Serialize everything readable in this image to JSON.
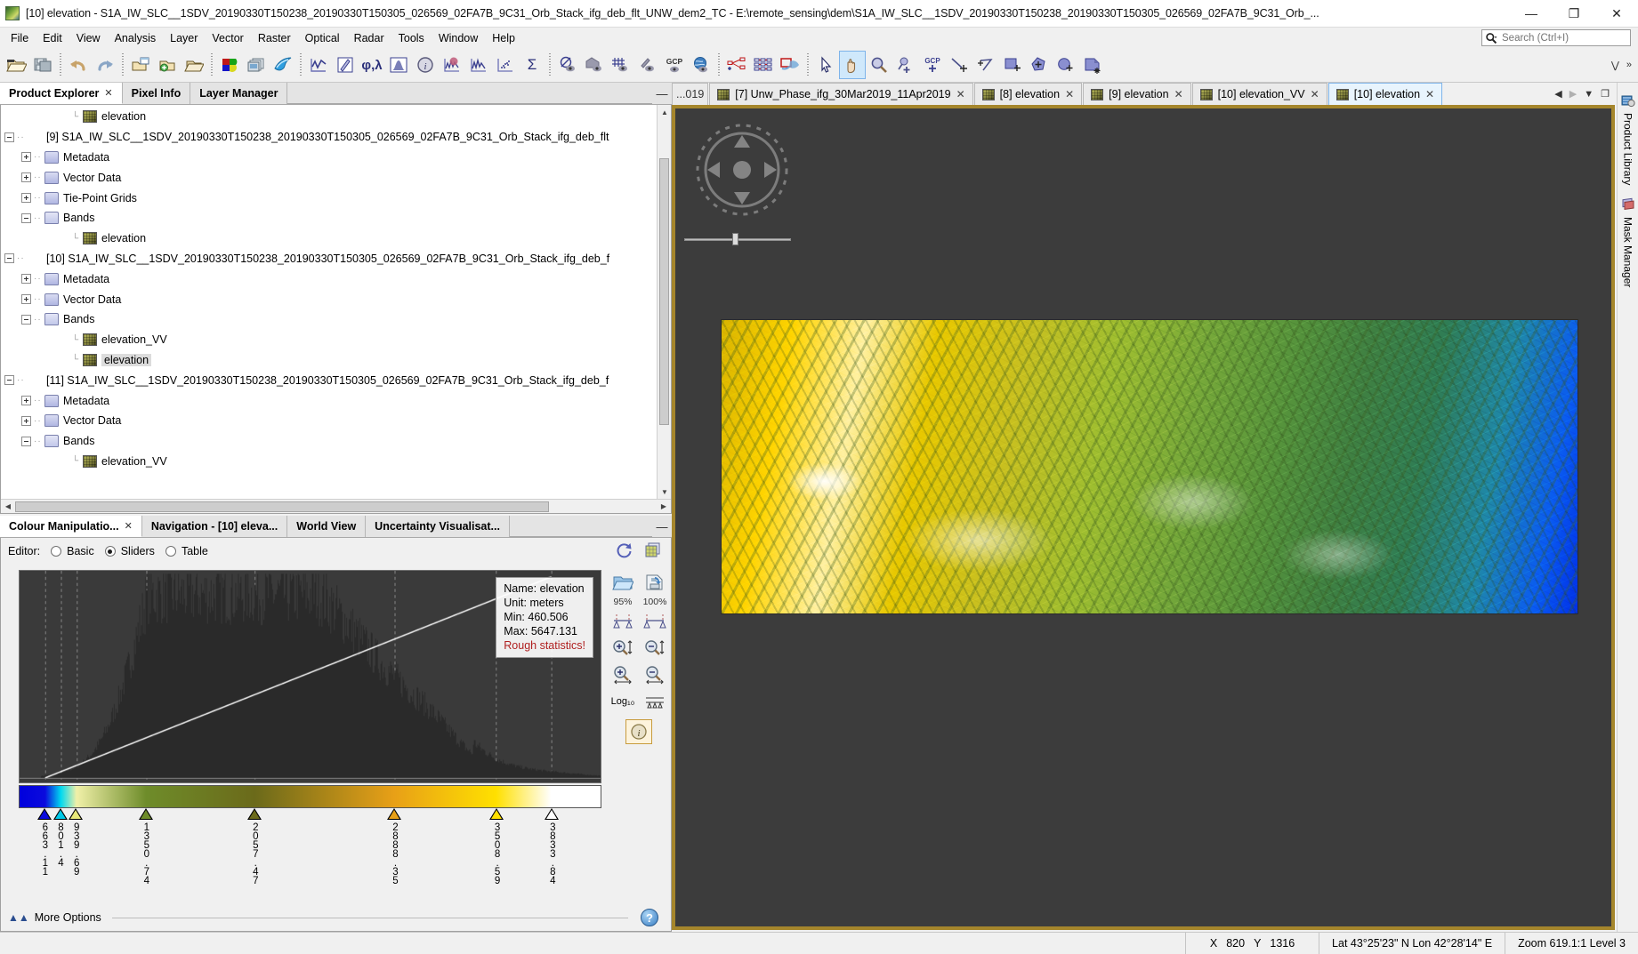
{
  "window": {
    "title": "[10] elevation - S1A_IW_SLC__1SDV_20190330T150238_20190330T150305_026569_02FA7B_9C31_Orb_Stack_ifg_deb_flt_UNW_dem2_TC - E:\\remote_sensing\\dem\\S1A_IW_SLC__1SDV_20190330T150238_20190330T150305_026569_02FA7B_9C31_Orb_...",
    "minimize": "—",
    "maximize": "❐",
    "close": "✕"
  },
  "menu": {
    "items": [
      "File",
      "Edit",
      "View",
      "Analysis",
      "Layer",
      "Vector",
      "Raster",
      "Optical",
      "Radar",
      "Tools",
      "Window",
      "Help"
    ]
  },
  "search": {
    "placeholder": "Search (Ctrl+I)",
    "value": "",
    "icon": "search-icon"
  },
  "toolbar": {
    "groups": [
      [
        {
          "name": "open-product-icon",
          "title": "Open Product"
        },
        {
          "name": "save-product-icon",
          "title": "Save Product"
        }
      ],
      [
        {
          "name": "undo-icon",
          "title": "Undo"
        },
        {
          "name": "redo-icon",
          "title": "Redo"
        }
      ],
      [
        {
          "name": "open-rgb-image-window-icon",
          "title": "Open RGB Image Window"
        },
        {
          "name": "open-image-view-icon",
          "title": "Open Image View"
        },
        {
          "name": "close-image-view-icon",
          "title": "Close Image View"
        }
      ],
      [
        {
          "name": "colour-manipulation-icon",
          "title": "Colour Manipulation"
        },
        {
          "name": "tile-windows-icon",
          "title": "Tile Windows"
        },
        {
          "name": "wave-icon",
          "title": "SAR Wave"
        }
      ],
      [
        {
          "name": "profile-plot-icon",
          "title": "Profile Plot"
        },
        {
          "name": "pin-manager-icon",
          "title": "Pin Manager"
        },
        {
          "name": "geo-coding-icon",
          "title": "Geo-Coding"
        },
        {
          "name": "histogram-icon",
          "title": "Histogram"
        },
        {
          "name": "information-icon",
          "title": "Information"
        },
        {
          "name": "colour-histogram-icon",
          "title": "Colour Histogram"
        },
        {
          "name": "density-plot-icon",
          "title": "Density Plot"
        },
        {
          "name": "scatter-plot-icon",
          "title": "Scatter Plot"
        },
        {
          "name": "statistics-icon",
          "title": "Statistics"
        }
      ],
      [
        {
          "name": "no-data-overlay-icon",
          "title": "No-Data Overlay"
        },
        {
          "name": "geometry-overlay-icon",
          "title": "Geometry Overlay"
        },
        {
          "name": "graticule-overlay-icon",
          "title": "Graticule Overlay"
        },
        {
          "name": "pin-overlay-icon",
          "title": "Pin Overlay"
        },
        {
          "name": "gcp-overlay-icon",
          "title": "GCP Overlay"
        },
        {
          "name": "world-map-overlay-icon",
          "title": "World Map Overlay"
        }
      ],
      [
        {
          "name": "graph-builder-icon",
          "title": "Graph Builder"
        },
        {
          "name": "batch-processing-icon",
          "title": "Batch Processing"
        },
        {
          "name": "subset-icon",
          "title": "Subset"
        }
      ],
      [
        {
          "name": "selection-tool-icon",
          "title": "Selection"
        },
        {
          "name": "pan-tool-icon",
          "title": "Panning",
          "active": true
        },
        {
          "name": "zoom-tool-icon",
          "title": "Zooming"
        },
        {
          "name": "pin-placing-tool-icon",
          "title": "Pin placing tool"
        },
        {
          "name": "gcp-placing-tool-icon",
          "title": "GCP placing tool"
        },
        {
          "name": "line-drawing-tool-icon",
          "title": "Line drawing tool"
        },
        {
          "name": "polyline-drawing-tool-icon",
          "title": "Polyline drawing tool"
        },
        {
          "name": "rectangle-drawing-tool-icon",
          "title": "Rectangle drawing tool"
        },
        {
          "name": "polygon-drawing-tool-icon",
          "title": "Polygon drawing tool"
        },
        {
          "name": "ellipse-drawing-tool-icon",
          "title": "Ellipse drawing tool"
        },
        {
          "name": "magic-wand-tool-icon",
          "title": "Magic wand tool"
        }
      ]
    ],
    "overflow_down": "⋁",
    "overflow_right": "»"
  },
  "left_panel": {
    "tabs": [
      {
        "label": "Product Explorer",
        "selected": true,
        "closable": true
      },
      {
        "label": "Pixel Info",
        "selected": false,
        "closable": false
      },
      {
        "label": "Layer Manager",
        "selected": false,
        "closable": false
      }
    ],
    "minimize": "—"
  },
  "tree": {
    "rows": [
      {
        "indent": 4,
        "toggle": "none",
        "icon": "band",
        "label": "elevation",
        "selected": false
      },
      {
        "indent": 0,
        "toggle": "minus",
        "icon": "product",
        "label": "[9] S1A_IW_SLC__1SDV_20190330T150238_20190330T150305_026569_02FA7B_9C31_Orb_Stack_ifg_deb_flt",
        "selected": false
      },
      {
        "indent": 1,
        "toggle": "plus",
        "icon": "folder",
        "label": "Metadata",
        "selected": false
      },
      {
        "indent": 1,
        "toggle": "plus",
        "icon": "folder",
        "label": "Vector Data",
        "selected": false
      },
      {
        "indent": 1,
        "toggle": "plus",
        "icon": "folder",
        "label": "Tie-Point Grids",
        "selected": false
      },
      {
        "indent": 1,
        "toggle": "minus",
        "icon": "folder-open",
        "label": "Bands",
        "selected": false
      },
      {
        "indent": 4,
        "toggle": "none",
        "icon": "band",
        "label": "elevation",
        "selected": false
      },
      {
        "indent": 0,
        "toggle": "minus",
        "icon": "product",
        "label": "[10] S1A_IW_SLC__1SDV_20190330T150238_20190330T150305_026569_02FA7B_9C31_Orb_Stack_ifg_deb_f",
        "selected": false
      },
      {
        "indent": 1,
        "toggle": "plus",
        "icon": "folder",
        "label": "Metadata",
        "selected": false
      },
      {
        "indent": 1,
        "toggle": "plus",
        "icon": "folder",
        "label": "Vector Data",
        "selected": false
      },
      {
        "indent": 1,
        "toggle": "minus",
        "icon": "folder-open",
        "label": "Bands",
        "selected": false
      },
      {
        "indent": 4,
        "toggle": "none",
        "icon": "band",
        "label": "elevation_VV",
        "selected": false
      },
      {
        "indent": 4,
        "toggle": "none",
        "icon": "band",
        "label": "elevation",
        "selected": true
      },
      {
        "indent": 0,
        "toggle": "minus",
        "icon": "product",
        "label": "[11] S1A_IW_SLC__1SDV_20190330T150238_20190330T150305_026569_02FA7B_9C31_Orb_Stack_ifg_deb_f",
        "selected": false
      },
      {
        "indent": 1,
        "toggle": "plus",
        "icon": "folder",
        "label": "Metadata",
        "selected": false
      },
      {
        "indent": 1,
        "toggle": "plus",
        "icon": "folder",
        "label": "Vector Data",
        "selected": false
      },
      {
        "indent": 1,
        "toggle": "minus",
        "icon": "folder-open",
        "label": "Bands",
        "selected": false
      },
      {
        "indent": 4,
        "toggle": "none",
        "icon": "band",
        "label": "elevation_VV",
        "selected": false
      }
    ]
  },
  "colour_panel": {
    "tabs": [
      {
        "label": "Colour Manipulatio...",
        "selected": true,
        "closable": true
      },
      {
        "label": "Navigation - [10] eleva...",
        "selected": false,
        "closable": false
      },
      {
        "label": "World View",
        "selected": false,
        "closable": false
      },
      {
        "label": "Uncertainty Visualisat...",
        "selected": false,
        "closable": false
      }
    ],
    "minimize": "—",
    "editor_label": "Editor:",
    "editor_options": [
      {
        "label": "Basic",
        "selected": false
      },
      {
        "label": "Sliders",
        "selected": true
      },
      {
        "label": "Table",
        "selected": false
      }
    ],
    "header_icons": [
      {
        "name": "reset-icon",
        "title": "Reset to defaults"
      },
      {
        "name": "multi-apply-icon",
        "title": "Apply to other bands"
      }
    ],
    "info": {
      "name": "Name: elevation",
      "unit": "Unit: meters",
      "min": "Min: 460.506",
      "max": "Max: 5647.131",
      "rough": "Rough statistics!"
    },
    "side_buttons": [
      {
        "name": "import-palette-icon",
        "title": "Import colour palette"
      },
      {
        "name": "export-palette-icon",
        "title": "Export colour palette"
      },
      {
        "name": "stretch-95-icon",
        "label": "95%",
        "title": "95% stretch"
      },
      {
        "name": "stretch-100-icon",
        "label": "100%",
        "title": "100% stretch"
      },
      {
        "name": "zoom-in-vertical-icon",
        "title": "Zoom in vertically"
      },
      {
        "name": "zoom-out-vertical-icon",
        "title": "Zoom out vertically"
      },
      {
        "name": "zoom-in-horizontal-icon",
        "title": "Zoom in horizontally"
      },
      {
        "name": "zoom-out-horizontal-icon",
        "title": "Zoom out horizontally"
      },
      {
        "name": "log10-display-icon",
        "label": "Log₁₀",
        "title": "Log10 display"
      },
      {
        "name": "evenly-distribute-icon",
        "title": "Distribute sliders evenly"
      },
      {
        "name": "show-extra-info-icon",
        "title": "Show extra information"
      }
    ],
    "more_options": "More Options",
    "help_label": "?"
  },
  "chart_data": {
    "type": "histogram",
    "title": "elevation histogram",
    "xlabel": "",
    "ylabel": "",
    "unit": "meters",
    "min": 460.506,
    "max": 5647.131,
    "statistics_note": "Rough statistics!",
    "slider_values": [
      663.11,
      801.4,
      939.69,
      1350.74,
      2057.47,
      2888.35,
      3508.59,
      3833.84
    ],
    "slider_colors": [
      "#0b0bdd",
      "#00c8e8",
      "#e8e87a",
      "#6e8c2a",
      "#6b6a1a",
      "#e8a017",
      "#ffe000",
      "#ffffff"
    ],
    "slider_positions_pct": [
      4.4,
      7.1,
      9.8,
      21.8,
      40.5,
      64.5,
      82.0,
      91.5
    ],
    "ramp_stops": [
      {
        "pos": 0,
        "color": "#0000dd"
      },
      {
        "pos": 4.4,
        "color": "#0b0bdd"
      },
      {
        "pos": 7.1,
        "color": "#00d8f0"
      },
      {
        "pos": 9.8,
        "color": "#f0f0a8"
      },
      {
        "pos": 21.8,
        "color": "#6e8c2a"
      },
      {
        "pos": 40.5,
        "color": "#6b6a1a"
      },
      {
        "pos": 64.5,
        "color": "#e8a017"
      },
      {
        "pos": 82.0,
        "color": "#ffe000"
      },
      {
        "pos": 91.5,
        "color": "#ffffff"
      },
      {
        "pos": 100,
        "color": "#ffffff"
      }
    ]
  },
  "doc_tabs": {
    "clipped_left": "...019",
    "tabs": [
      {
        "label": "[7] Unw_Phase_ifg_30Mar2019_11Apr2019",
        "selected": false
      },
      {
        "label": "[8] elevation",
        "selected": false
      },
      {
        "label": "[9] elevation",
        "selected": false
      },
      {
        "label": "[10] elevation_VV",
        "selected": false
      },
      {
        "label": "[10] elevation",
        "selected": true
      }
    ],
    "close_glyph": "✕",
    "controls": [
      {
        "name": "scroll-tabs-left-button",
        "glyph": "◀",
        "enabled": true
      },
      {
        "name": "scroll-tabs-right-button",
        "glyph": "▶",
        "enabled": false
      },
      {
        "name": "tab-list-button",
        "glyph": "▼",
        "enabled": true
      },
      {
        "name": "maximize-view-button",
        "glyph": "❐",
        "enabled": true
      }
    ]
  },
  "image_view": {
    "navigation_compass": "navigation-compass-icon",
    "zoom_slider": "zoom-slider"
  },
  "right_bar": {
    "tabs": [
      {
        "label": "Product Library",
        "icon": "product-library-icon"
      },
      {
        "label": "Mask Manager",
        "icon": "mask-manager-icon"
      }
    ]
  },
  "status_bar": {
    "x_label": "X",
    "x_value": "820",
    "y_label": "Y",
    "y_value": "1316",
    "geo": "Lat 43°25'23\" N Lon 42°28'14\" E",
    "zoom": "Zoom 619.1:1 Level 3"
  },
  "colors": {
    "accent": "#7eb4ea",
    "view_border": "#a5862c",
    "canvas_bg": "#3c3c3c",
    "warning": "#b02020"
  }
}
